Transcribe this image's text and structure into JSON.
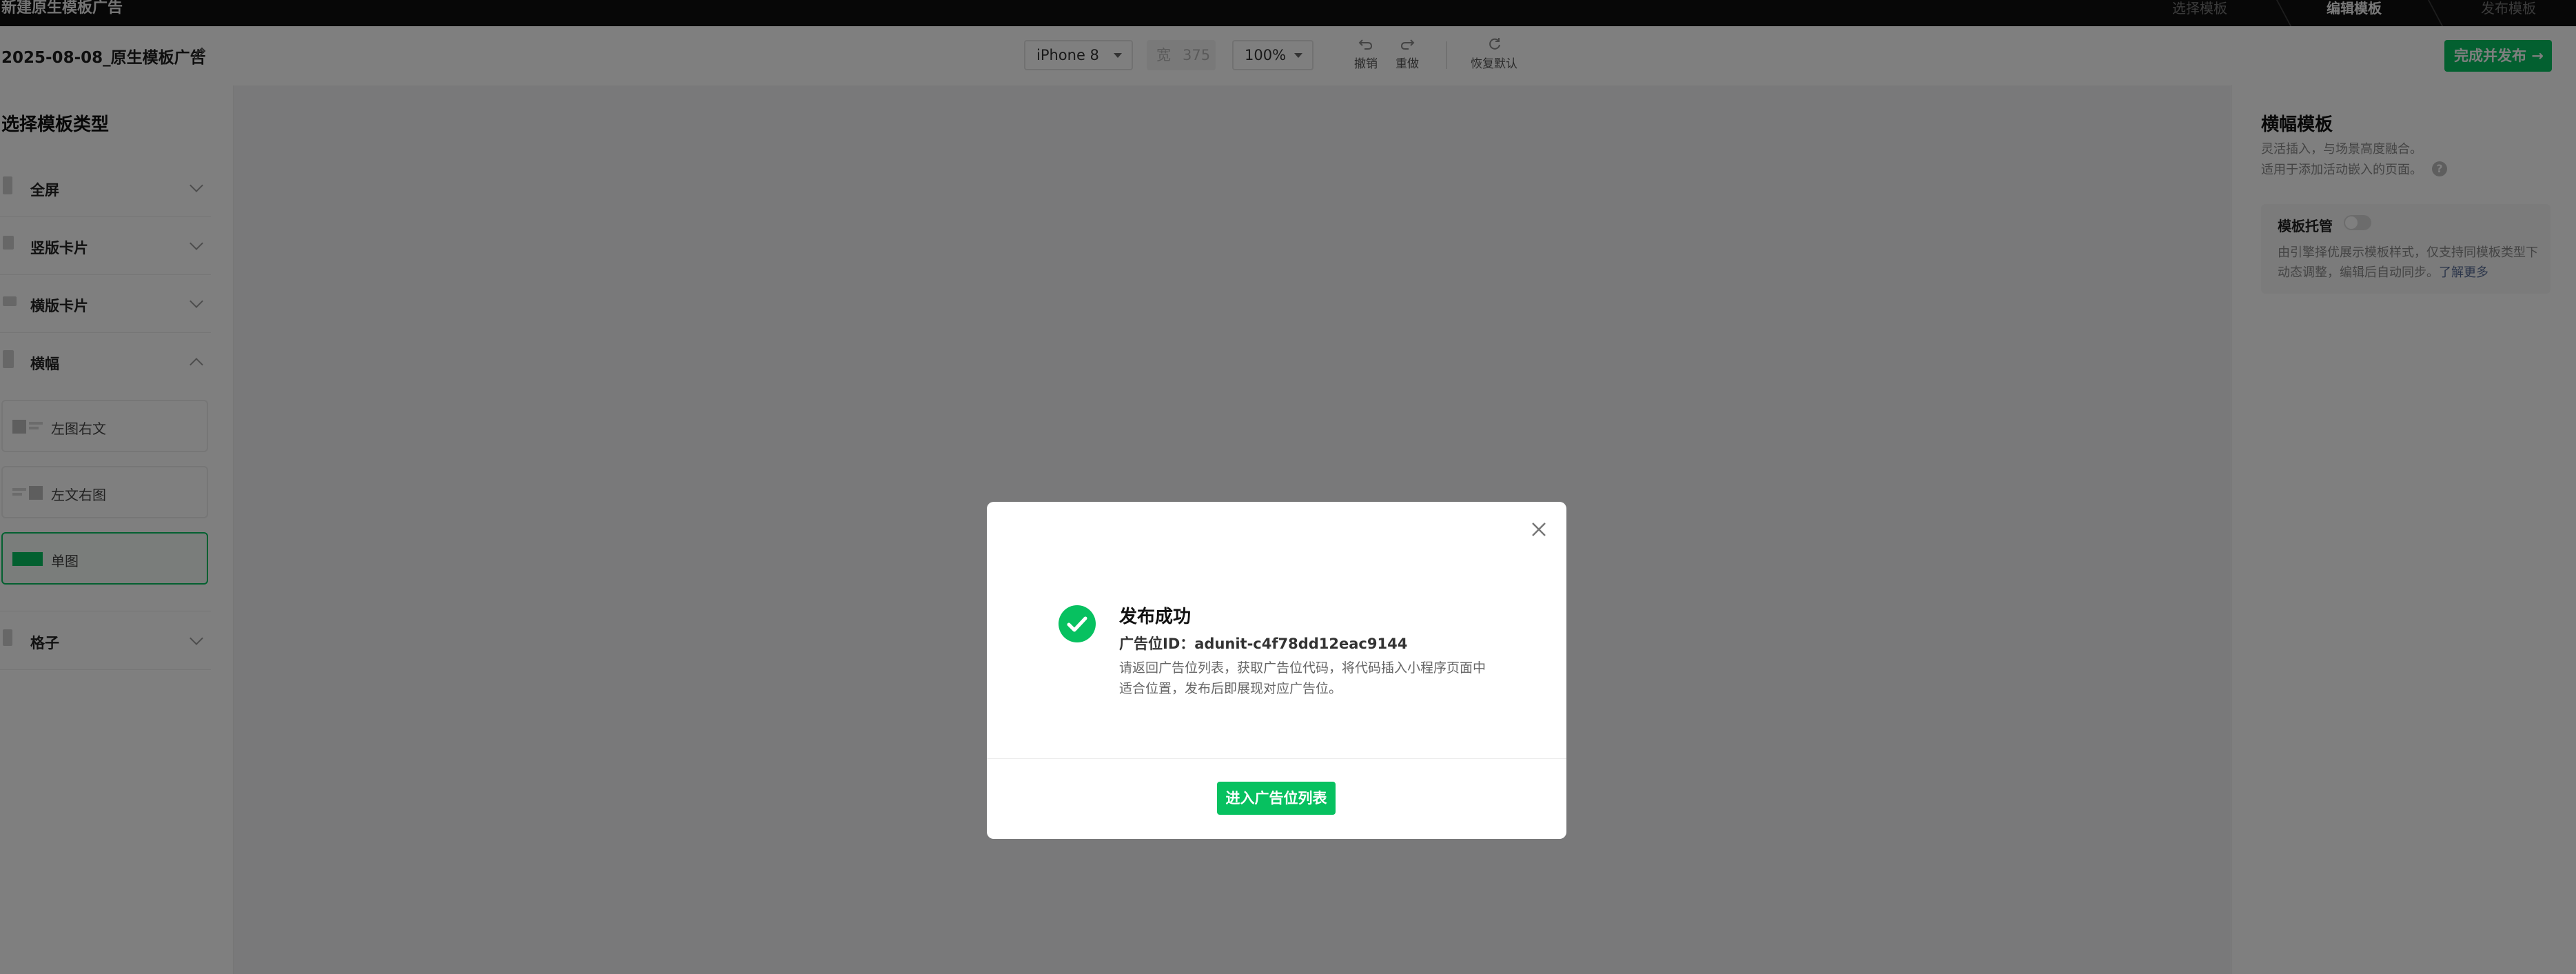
{
  "topbar": {
    "title": "新建原生模板广告",
    "steps": [
      "选择模板",
      "编辑模板",
      "发布模板"
    ],
    "active_step": 1
  },
  "toolbar": {
    "doc_title": "2025-08-08_原生模板广告",
    "device": "iPhone 8",
    "width_label": "宽",
    "width_value": "375",
    "zoom": "100%",
    "undo_label": "撤销",
    "redo_label": "重做",
    "reset_label": "恢复默认",
    "publish_label": "完成并发布"
  },
  "sidebar": {
    "heading": "选择模板类型",
    "categories": [
      {
        "label": "全屏",
        "expanded": false
      },
      {
        "label": "竖版卡片",
        "expanded": false
      },
      {
        "label": "横版卡片",
        "expanded": false
      },
      {
        "label": "横幅",
        "expanded": true
      },
      {
        "label": "格子",
        "expanded": false
      }
    ],
    "banner_options": [
      {
        "label": "左图右文",
        "selected": false
      },
      {
        "label": "左文右图",
        "selected": false
      },
      {
        "label": "单图",
        "selected": true
      }
    ]
  },
  "right_panel": {
    "title": "横幅模板",
    "desc_line1": "灵活插入，与场景高度融合。",
    "desc_line2": "适用于添加活动嵌入的页面。",
    "card_title": "模板托管",
    "toggle_on": false,
    "card_desc": "由引擎择优展示模板样式，仅支持同模板类型下动态调整，编辑后自动同步。",
    "learn_more": "了解更多"
  },
  "modal": {
    "title": "发布成功",
    "id_label": "广告位ID：adunit-c4f78dd12eac9144",
    "desc_line1": "请返回广告位列表，获取广告位代码，将代码插入小程序页面中",
    "desc_line2": "适合位置，发布后即展现对应广告位。",
    "button_label": "进入广告位列表"
  },
  "colors": {
    "accent": "#07c160",
    "topbar_bg": "#0f0f0f",
    "overlay": "rgba(0,0,0,0.5)",
    "link": "#576b95"
  }
}
